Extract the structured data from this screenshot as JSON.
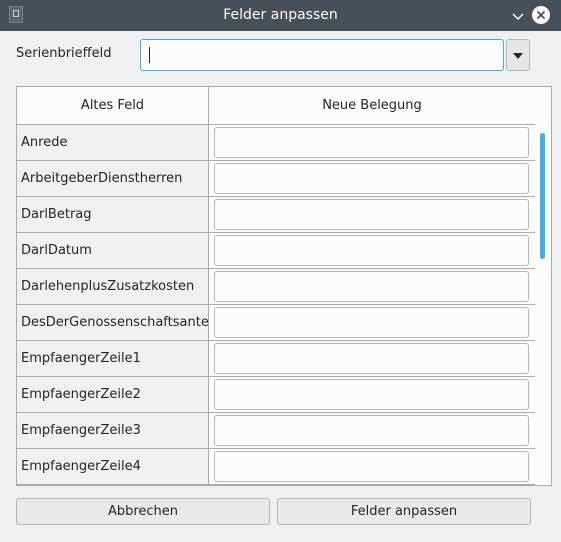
{
  "window": {
    "title": "Felder anpassen"
  },
  "field_selector": {
    "label": "Serienbrieffeld",
    "value": ""
  },
  "table": {
    "headers": [
      "Altes Feld",
      "Neue Belegung"
    ],
    "rows": [
      {
        "old_field": "Anrede",
        "new_value": ""
      },
      {
        "old_field": "ArbeitgeberDienstherren",
        "new_value": ""
      },
      {
        "old_field": "DarlBetrag",
        "new_value": ""
      },
      {
        "old_field": "DarlDatum",
        "new_value": ""
      },
      {
        "old_field": "DarlehenplusZusatzkosten",
        "new_value": ""
      },
      {
        "old_field": "DesDerGenossenschaftsanteile",
        "new_value": ""
      },
      {
        "old_field": "EmpfaengerZeile1",
        "new_value": ""
      },
      {
        "old_field": "EmpfaengerZeile2",
        "new_value": ""
      },
      {
        "old_field": "EmpfaengerZeile3",
        "new_value": ""
      },
      {
        "old_field": "EmpfaengerZeile4",
        "new_value": ""
      }
    ]
  },
  "buttons": {
    "cancel": "Abbrechen",
    "apply": "Felder anpassen"
  },
  "icons": {
    "app": "document-icon",
    "minimize": "chevron-down-icon",
    "close": "close-icon",
    "dropdown": "triangle-down-icon"
  },
  "colors": {
    "titlebar": "#475057",
    "focus_accent": "#3daee9",
    "window_background": "#eff0f1"
  }
}
